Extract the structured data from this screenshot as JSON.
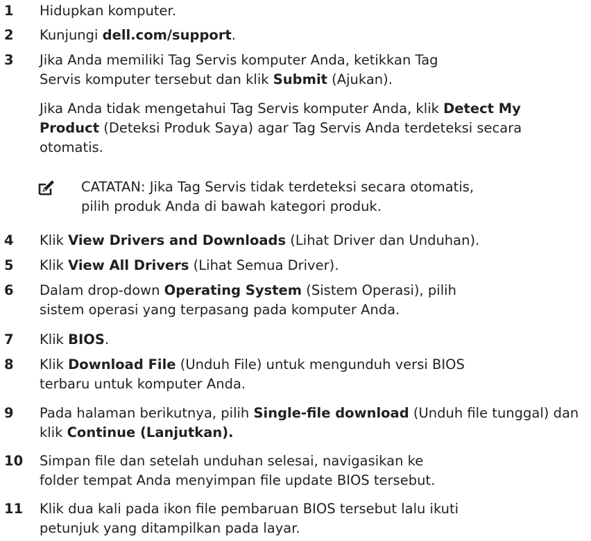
{
  "steps": [
    {
      "n": "1",
      "parts": [
        "Hidupkan komputer."
      ]
    },
    {
      "n": "2",
      "parts": [
        "Kunjungi ",
        "dell.com/support",
        "."
      ]
    },
    {
      "n": "3",
      "parts": [
        "Jika Anda memiliki Tag Servis komputer Anda, ketikkan Tag Servis komputer tersebut dan klik ",
        "Submit",
        " (Ajukan)."
      ]
    },
    {
      "n": "4",
      "parts": [
        "Klik ",
        "View Drivers and Downloads",
        " (Lihat Driver dan Unduhan)."
      ]
    },
    {
      "n": "5",
      "parts": [
        "Klik ",
        "View All Drivers",
        " (Lihat Semua Driver)."
      ]
    },
    {
      "n": "6",
      "parts": [
        "Dalam drop-down ",
        "Operating System",
        " (Sistem Operasi), pilih sistem operasi yang terpasang pada komputer Anda."
      ]
    },
    {
      "n": "7",
      "parts": [
        "Klik ",
        "BIOS",
        "."
      ]
    },
    {
      "n": "8",
      "parts": [
        "Klik ",
        "Download File",
        " (Unduh File) untuk mengunduh versi BIOS terbaru untuk komputer Anda."
      ]
    },
    {
      "n": "9",
      "parts": [
        "Pada halaman berikutnya, pilih ",
        "Single-file download",
        " (Unduh file tunggal) dan klik ",
        "Continue (Lanjutkan)."
      ]
    },
    {
      "n": "10",
      "parts": [
        "Simpan file dan setelah unduhan selesai, navigasikan ke folder tempat Anda menyimpan file update BIOS tersebut."
      ]
    },
    {
      "n": "11",
      "parts": [
        "Klik dua kali pada ikon file pembaruan BIOS tersebut lalu ikuti petunjuk yang ditampilkan pada layar."
      ]
    }
  ],
  "step3_extra": {
    "parts": [
      "Jika Anda tidak mengetahui Tag Servis komputer Anda, klik ",
      "Detect My Product",
      " (Deteksi Produk Saya) agar Tag Servis Anda terdeteksi secara otomatis."
    ]
  },
  "note": {
    "label": "CATATAN:",
    "text": " Jika Tag Servis tidak terdeteksi secara otomatis, pilih produk Anda di bawah kategori produk.",
    "icon": "pencil-note-icon"
  }
}
